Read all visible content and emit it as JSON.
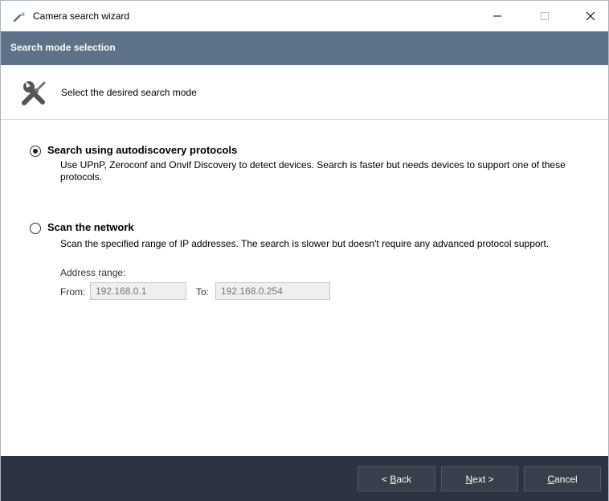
{
  "window": {
    "title": "Camera search wizard",
    "controls": {
      "minimize": "—",
      "maximize": "□",
      "close": "✕"
    }
  },
  "header": {
    "title": "Search mode selection"
  },
  "subheader": {
    "text": "Select the desired search mode",
    "icon": "tools-icon"
  },
  "options": {
    "autodiscovery": {
      "label": "Search using autodiscovery protocols",
      "description": "Use UPnP, Zeroconf and Onvif Discovery to detect devices. Search is faster but needs devices to support one of these protocols.",
      "selected": true
    },
    "scan": {
      "label": "Scan the network",
      "description": "Scan the specified range of IP addresses. The search is slower but doesn't require any advanced protocol support.",
      "selected": false
    }
  },
  "range": {
    "label": "Address range:",
    "from_label": "From:",
    "from_value": "192.168.0.1",
    "to_label": "To:",
    "to_value": "192.168.0.254"
  },
  "footer": {
    "back": {
      "prefix": "< ",
      "mnemonic": "B",
      "rest": "ack"
    },
    "next": {
      "mnemonic": "N",
      "rest": "ext >"
    },
    "cancel": {
      "mnemonic": "C",
      "rest": "ancel"
    }
  },
  "colors": {
    "header": "#5d7188",
    "footer": "#2b3440",
    "button": "#363f4a"
  }
}
